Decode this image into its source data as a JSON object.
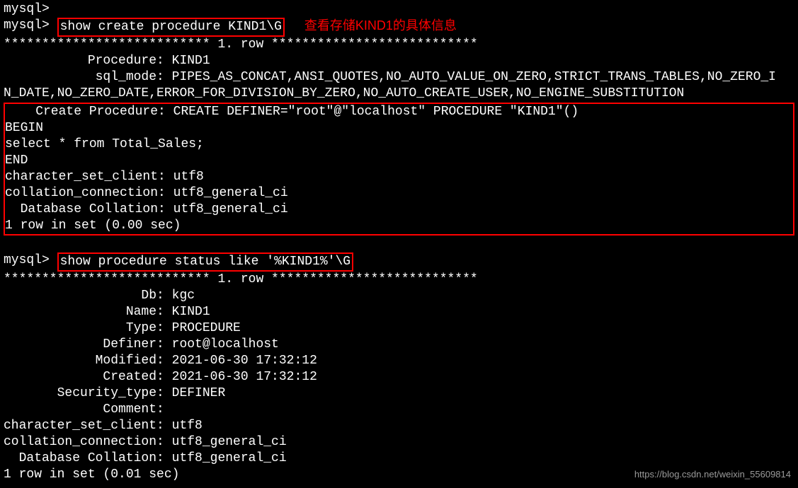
{
  "prompt": "mysql> ",
  "empty_prompts_top": [
    "mysql>",
    "mysql> "
  ],
  "cmd1": "show create procedure KIND1\\G",
  "annotation1": "查看存储KIND1的具体信息",
  "row_sep1": "*************************** 1. row ***************************",
  "result1": {
    "line_proc": "           Procedure: KIND1",
    "line_sqlmode_a": "            sql_mode: PIPES_AS_CONCAT,ANSI_QUOTES,NO_AUTO_VALUE_ON_ZERO,STRICT_TRANS_TABLES,NO_ZERO_I",
    "line_sqlmode_b": "N_DATE,NO_ZERO_DATE,ERROR_FOR_DIVISION_BY_ZERO,NO_AUTO_CREATE_USER,NO_ENGINE_SUBSTITUTION"
  },
  "boxed_block": {
    "l1": "    Create Procedure: CREATE DEFINER=\"root\"@\"localhost\" PROCEDURE \"KIND1\"()",
    "l2": "BEGIN",
    "l3": "select * from Total_Sales;",
    "l4": "END",
    "l5": "character_set_client: utf8",
    "l6": "collation_connection: utf8_general_ci",
    "l7": "  Database Collation: utf8_general_ci",
    "l8": "1 row in set (0.00 sec)"
  },
  "cmd2": "show procedure status like '%KIND1%'\\G",
  "row_sep2": "*************************** 1. row ***************************",
  "result2": {
    "db": "                  Db: kgc",
    "name": "                Name: KIND1",
    "type": "                Type: PROCEDURE",
    "definer": "             Definer: root@localhost",
    "modified": "            Modified: 2021-06-30 17:32:12",
    "created": "             Created: 2021-06-30 17:32:12",
    "sectype": "       Security_type: DEFINER",
    "comment": "             Comment:",
    "charset": "character_set_client: utf8",
    "coll": "collation_connection: utf8_general_ci",
    "dbcoll": "  Database Collation: utf8_general_ci",
    "footer": "1 row in set (0.01 sec)"
  },
  "watermark": "https://blog.csdn.net/weixin_55609814"
}
